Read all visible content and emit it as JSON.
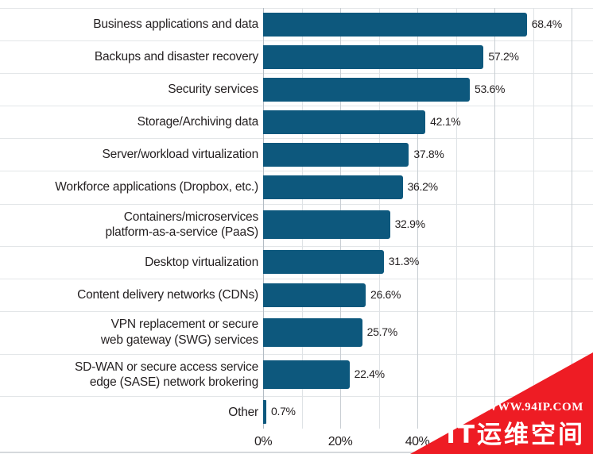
{
  "chart_data": {
    "type": "bar",
    "orientation": "horizontal",
    "title": "",
    "subtitle": "",
    "xlabel": "",
    "ylabel": "",
    "xlim": [
      0,
      83
    ],
    "grid": true,
    "gridline_step": 10,
    "legend": "none",
    "value_suffix": "%",
    "categories": [
      "Business applications and data",
      "Backups and disaster recovery",
      "Security services",
      "Storage/Archiving data",
      "Server/workload virtualization",
      "Workforce applications (Dropbox, etc.)",
      "Containers/microservices\nplatform-as-a-service (PaaS)",
      "Desktop virtualization",
      "Content delivery networks (CDNs)",
      "VPN replacement or secure\nweb gateway (SWG) services",
      "SD-WAN or secure access service\nedge (SASE) network brokering",
      "Other"
    ],
    "values": [
      68.4,
      57.2,
      53.6,
      42.1,
      37.8,
      36.2,
      32.9,
      31.3,
      26.6,
      25.7,
      22.4,
      0.7
    ],
    "value_labels": [
      "68.4%",
      "57.2%",
      "53.6%",
      "42.1%",
      "37.8%",
      "36.2%",
      "32.9%",
      "31.3%",
      "26.6%",
      "25.7%",
      "22.4%",
      "0.7%"
    ],
    "xticks": [
      0,
      20,
      40
    ],
    "xtick_labels": [
      "0%",
      "20%",
      "40%"
    ],
    "colors": {
      "bar": "#0d587d",
      "text": "#231f20",
      "gridline": "#dfe3e6",
      "row_separator": "#e3e6e8",
      "background": "#ffffff"
    }
  },
  "watermark": {
    "url": "WWW.94IP.COM",
    "name": "IT运维空间",
    "color": "#ee1c24"
  }
}
